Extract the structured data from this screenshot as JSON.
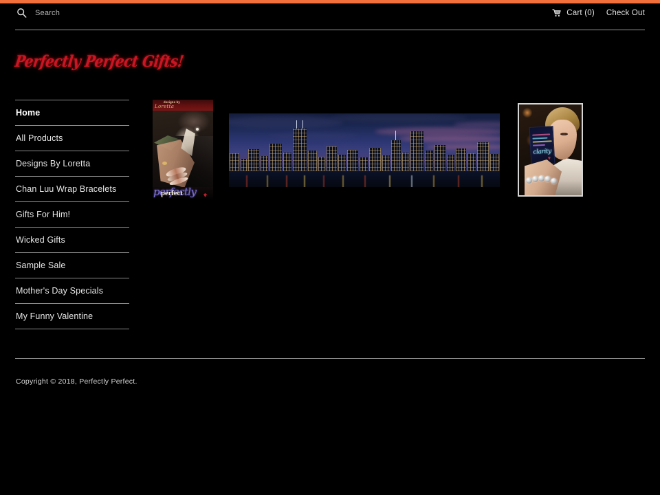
{
  "site": {
    "background_color": "#000000",
    "accent_color": "#f2703c",
    "logo_color": "#cc1522",
    "logo_text": "Perfectly Perfect Gifts!"
  },
  "header": {
    "search": {
      "icon": "search-icon",
      "placeholder": "Search",
      "value": ""
    },
    "cart": {
      "icon": "shopping-cart-icon",
      "label": "Cart (0)",
      "count": 0
    },
    "checkout_label": "Check Out"
  },
  "sidebar": {
    "items": [
      {
        "label": "Home",
        "active": true
      },
      {
        "label": "All Products",
        "active": false
      },
      {
        "label": "Designs By Loretta",
        "active": false
      },
      {
        "label": "Chan Luu Wrap Bracelets",
        "active": false
      },
      {
        "label": "Gifts For Him!",
        "active": false
      },
      {
        "label": "Wicked Gifts",
        "active": false
      },
      {
        "label": "Sample Sale",
        "active": false
      },
      {
        "label": "Mother's Day Specials",
        "active": false
      },
      {
        "label": "My Funny Valentine",
        "active": false
      }
    ]
  },
  "main": {
    "images": [
      {
        "name": "designs-by-loretta-tuxedo-bracelets",
        "overlay_top_small": "designs by",
        "overlay_top_script": "Loretta",
        "overlay_bottom_script": "perfectly",
        "overlay_bottom_bold": "perfect"
      },
      {
        "name": "chicago-skyline-night-banner",
        "alt": "City skyline at dusk over water"
      },
      {
        "name": "woman-holding-card-with-bracelet",
        "alt": "Woman holding a card, wearing a silver bracelet",
        "card_script": "clarity"
      }
    ]
  },
  "footer": {
    "copyright": "Copyright © 2018, Perfectly Perfect."
  }
}
